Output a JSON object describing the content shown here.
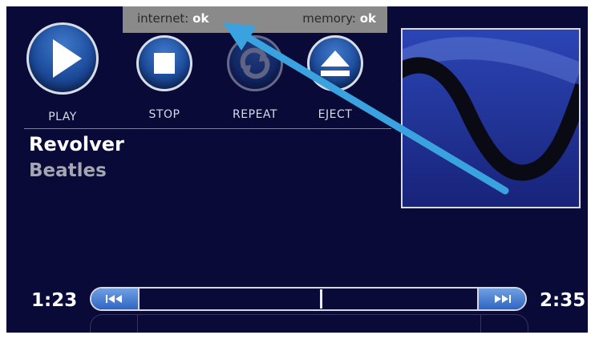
{
  "status": {
    "internet_label": "internet:",
    "internet_value": "ok",
    "memory_label": "memory:",
    "memory_value": "ok"
  },
  "controls": {
    "play_label": "PLAY",
    "stop_label": "STOP",
    "repeat_label": "REPEAT",
    "eject_label": "EJECT"
  },
  "track": {
    "album": "Revolver",
    "artist": "Beatles"
  },
  "playback": {
    "elapsed": "1:23",
    "total": "2:35",
    "progress_fraction": 0.535
  },
  "icons": {
    "play": "play-icon",
    "stop": "stop-icon",
    "repeat": "repeat-icon",
    "eject": "eject-icon",
    "rewind": "rewind-icon",
    "forward": "fast-forward-icon"
  },
  "colors": {
    "background": "#0a0a38",
    "accent": "#2f66c4",
    "annotation_arrow": "#3aa2de",
    "status_bar": "#8a8a8a"
  }
}
